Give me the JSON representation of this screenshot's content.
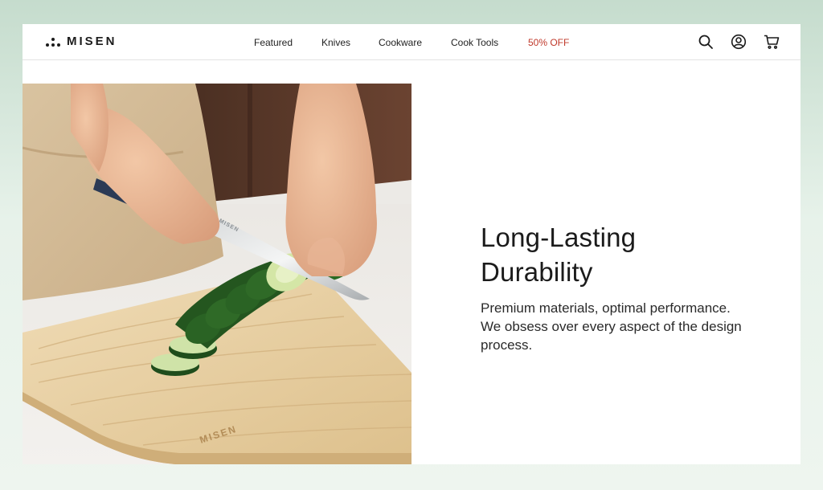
{
  "brand": {
    "name": "MISEN"
  },
  "nav": {
    "items": [
      {
        "label": "Featured"
      },
      {
        "label": "Knives"
      },
      {
        "label": "Cookware"
      },
      {
        "label": "Cook Tools"
      },
      {
        "label": "50% OFF",
        "color": "#c0392b"
      }
    ],
    "icons": [
      "search-icon",
      "account-icon",
      "cart-icon"
    ]
  },
  "hero": {
    "image": "hands-slicing-zucchini-on-wooden-board",
    "board_branding": "MISEN",
    "blade_branding": "MISEN",
    "headline_line1": "Long-Lasting",
    "headline_line2": "Durability",
    "body": "Premium materials, optimal performance. We obsess over every aspect of the design process."
  },
  "colors": {
    "sale": "#c0392b",
    "text": "#1b1b1b",
    "background_outer": "#dcebe0",
    "board": "#e3c99a"
  }
}
